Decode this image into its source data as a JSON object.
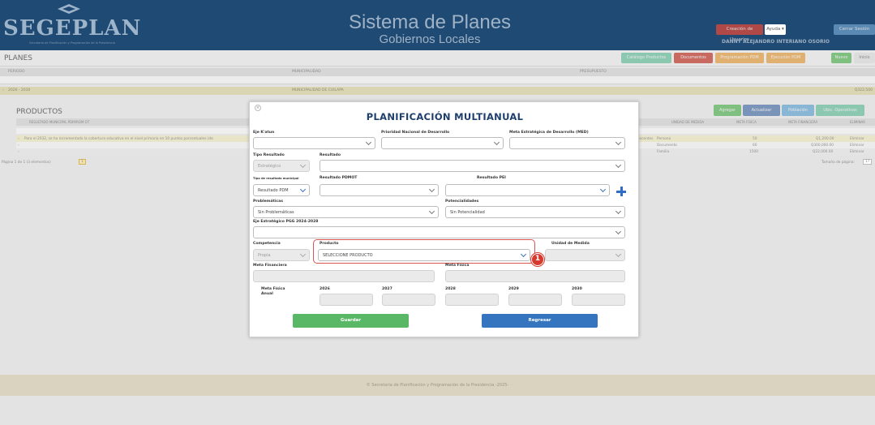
{
  "header": {
    "logo_text": "SEGEPLAN",
    "logo_subtitle": "Secretaría de Planificación y Programación de la Presidencia",
    "system_title": "Sistema de Planes",
    "system_subtitle": "Gobiernos Locales",
    "btn_usuarios": "Creación de Usuarios",
    "btn_ayuda": "Ayuda",
    "btn_cerrar": "Cerrar Sesión",
    "user_name": "DANNY ALEJANDRO INTERIANO OSORIO"
  },
  "planes": {
    "title": "PLANES",
    "buttons": [
      "Catálogo Productos",
      "Documentos",
      "Programación PDM",
      "Ejecución PDM",
      "Nuevo",
      "Inicio"
    ],
    "columns": [
      "PERIODO",
      "MUNICIPALIDAD",
      "PRESUPUESTO"
    ],
    "row": {
      "periodo": "2026 - 2030",
      "municipalidad": "MUNICIPALIDAD DE CUILAPA",
      "presupuesto": "Q322,500"
    }
  },
  "productos": {
    "title": "PRODUCTOS",
    "buttons": [
      "Agregar",
      "Actualizar",
      "Población",
      "Ubic. Operativas"
    ],
    "columns": [
      "RESULTADO MUNICIPAL PDM/ROM OT",
      "UNIDAD DE MEDIDA",
      "META FISICA",
      "META FINANCIERA",
      "ELIMINAR"
    ],
    "rows": [
      {
        "resultado": "Para el 2032, se ha incrementado la cobertura educativa en el nivel primaria en 10 puntos porcentuales (de",
        "extra": "adolescentes",
        "unidad": "Persona",
        "meta_fisica": "50",
        "meta_fin": "Q1,200.00",
        "eliminar": "Eliminar"
      },
      {
        "resultado": "",
        "extra": "",
        "unidad": "Documento",
        "meta_fisica": "60",
        "meta_fin": "Q300,000.00",
        "eliminar": "Eliminar"
      },
      {
        "resultado": "",
        "extra": "",
        "unidad": "Familia",
        "meta_fisica": "1500",
        "meta_fin": "Q22,000.00",
        "eliminar": "Eliminar"
      }
    ],
    "pager_text": "Página 1 de 1 (3 elementos)",
    "pager_page": "1",
    "page_size_label": "Tamaño de página:",
    "page_size": "17"
  },
  "footer": {
    "text": "© Secretaría de Planificación y Programación de la Presidencia -2025-"
  },
  "modal": {
    "close": "×",
    "title": "PLANIFICACIÓN MULTIANUAL",
    "labels": {
      "eje_katun": "Eje K'atun",
      "prioridad": "Prioridad Nacional de Desarrollo",
      "meta_med": "Meta Estratégica de Desarrollo (MED)",
      "tipo_resultado": "Tipo Resultado",
      "resultado": "Resultado",
      "tipo_municipal": "Tipo de resultado municipal",
      "resultado_pdmot": "Resultado PDMOT",
      "resultado_pei": "Resultado PEI",
      "problematicas": "Problemáticas",
      "potencialidades": "Potencialidades",
      "eje_pgg": "Eje Estratégico PGG 2024-2028",
      "competencia": "Competencia",
      "producto": "Producto",
      "unidad_medida": "Unidad de Medida",
      "meta_financiera": "Meta Financiera",
      "meta_fisica": "Meta Física",
      "meta_fisica_anual": "Meta Física Anual"
    },
    "values": {
      "tipo_resultado": "Estratégico",
      "tipo_municipal": "Resultado PDM",
      "problematicas": "Sin Problemáticas",
      "potencialidades": "Sin Potencialidad",
      "competencia": "Propia",
      "producto": "SELECCIONE PRODUCTO"
    },
    "years": [
      "2026",
      "2027",
      "2028",
      "2029",
      "2030"
    ],
    "btn_guardar": "Guardar",
    "btn_regresar": "Regresar",
    "callout_number": "1"
  },
  "colors": {
    "header_bg": "#1f4a73",
    "modal_title": "#1e3f6c",
    "save_green": "#59b865",
    "back_blue": "#3575c0",
    "callout_red": "#d63a2f"
  }
}
